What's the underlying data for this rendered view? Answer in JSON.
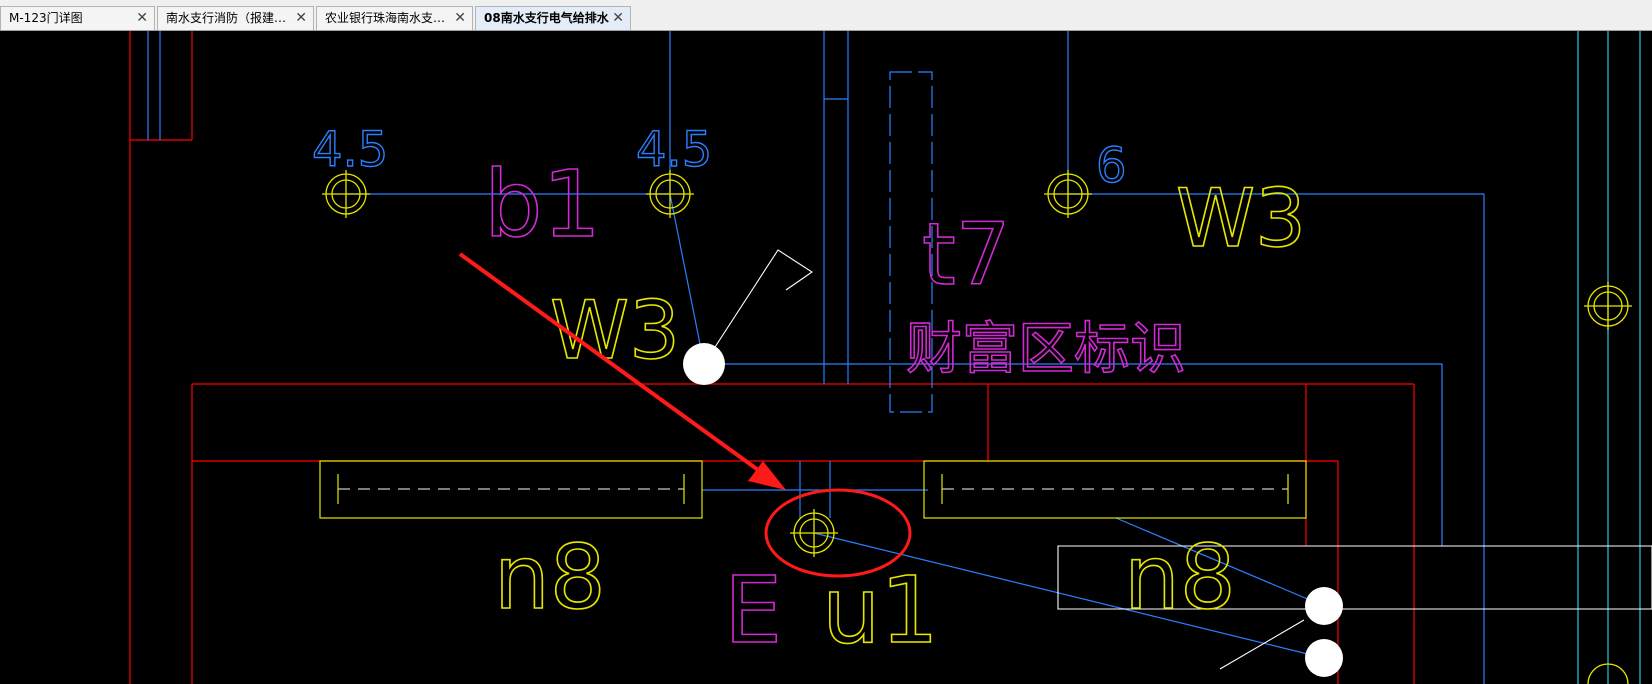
{
  "tabs": [
    {
      "label": "M-123门详图",
      "close": "✕"
    },
    {
      "label": "南水支行消防（报建…",
      "close": "✕"
    },
    {
      "label": "农业银行珠海南水支…",
      "close": "✕"
    },
    {
      "label": "08南水支行电气给排水",
      "close": "✕"
    }
  ],
  "active_tab_index": 3,
  "drawing": {
    "labels": {
      "elev_1": "4.5",
      "elev_2": "4.5",
      "elev_3": "6",
      "b1": "b1",
      "t7": "t7",
      "w3_top": "W3",
      "w3_mid": "W3",
      "wealth_zone": "财富区标识",
      "n8_left": "n8",
      "n8_right": "n8",
      "e_label": "E",
      "u1": "u1"
    },
    "colors": {
      "background": "#000000",
      "wall": "#ff0000",
      "pipe": "#2a7fff",
      "cyan": "#22c8e6",
      "fixture": "#e6e600",
      "text_yellow": "#e6e600",
      "text_magenta": "#d22ad2",
      "annotation": "#ff1a1a",
      "white": "#ffffff"
    }
  }
}
